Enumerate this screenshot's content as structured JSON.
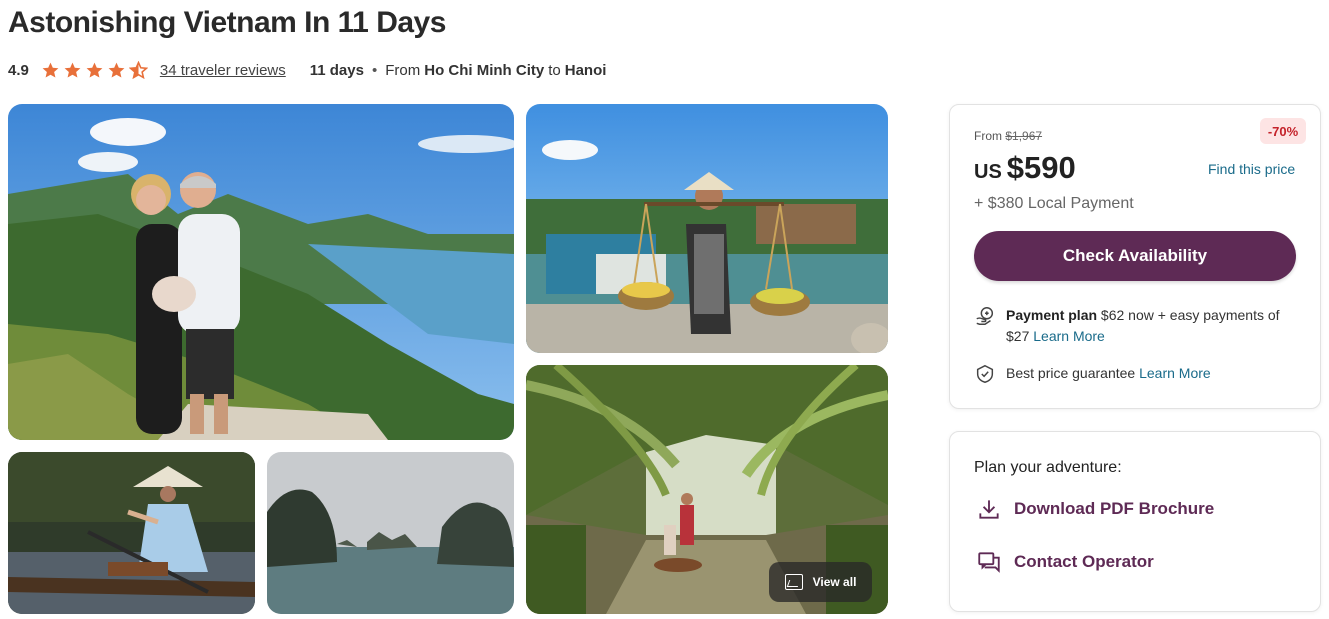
{
  "header": {
    "title": "Astonishing Vietnam In 11 Days",
    "rating": "4.9",
    "stars": 4.5,
    "reviews_link": "34 traveler reviews",
    "duration": "11 days",
    "separator": "•",
    "from_label": "From",
    "from_city": "Ho Chi Minh City",
    "to_label": "to",
    "to_city": "Hanoi"
  },
  "gallery": {
    "view_all_label": "View all"
  },
  "pricing": {
    "from_label": "From",
    "original_price": "$1,967",
    "discount_badge": "-70%",
    "currency": "US",
    "price": "$590",
    "find_price_link": "Find this price",
    "local_payment": "+ $380 Local Payment",
    "check_button": "Check Availability",
    "payment_plan_label": "Payment plan",
    "payment_plan_text": "$62 now + easy payments of $27",
    "payment_plan_link": "Learn More",
    "best_price_text": "Best price guarantee",
    "best_price_link": "Learn More"
  },
  "plan": {
    "title": "Plan your adventure:",
    "download_label": "Download PDF Brochure",
    "contact_label": "Contact Operator"
  },
  "colors": {
    "accent": "#5e2a55",
    "link": "#1a6b8a",
    "star": "#e8703a",
    "discount_text": "#c4222a",
    "discount_bg": "#fde4e4"
  },
  "icons": [
    "star-icon",
    "half-star-icon",
    "gallery-icon",
    "payment-plan-icon",
    "price-guarantee-icon",
    "download-icon",
    "contact-icon"
  ]
}
